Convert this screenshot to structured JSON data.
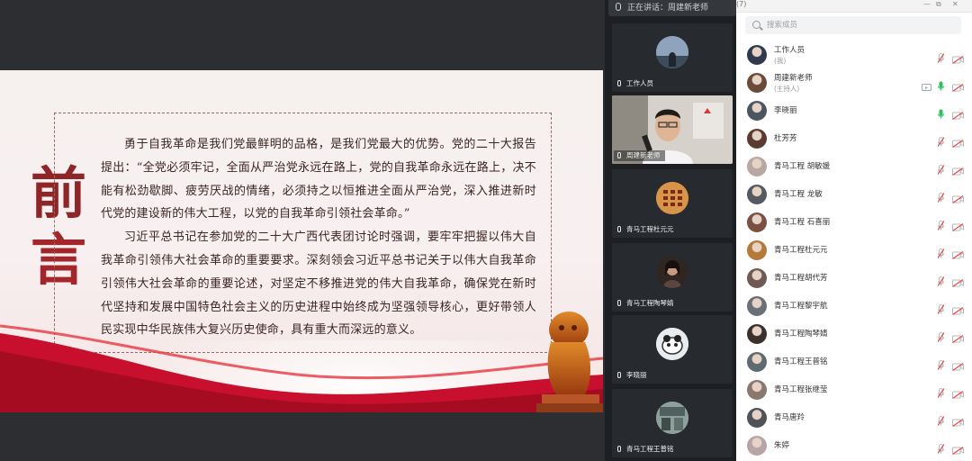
{
  "speaking": {
    "text": "正在讲话：周建新老师"
  },
  "slide": {
    "title": "前言",
    "paragraphs": [
      "勇于自我革命是我们党最鲜明的品格，是我们党最大的优势。党的二十大报告提出：“全党必须牢记，全面从严治党永远在路上，党的自我革命永远在路上，决不能有松劲歇脚、疲劳厌战的情绪，必须持之以恒推进全面从严治党，深入推进新时代党的建设新的伟大工程，以党的自我革命引领社会革命。”",
      "习近平总书记在参加党的二十大广西代表团讨论时强调，要牢牢把握以伟大自我革命引领伟大社会革命的重要要求。深刻领会习近平总书记关于以伟大自我革命引领伟大社会革命的重要论述，对坚定不移推进党的伟大自我革命，确保党在新时代坚持和发展中国特色社会主义的历史进程中始终成为坚强领导核心，更好带领人民实现中华民族伟大复兴历史使命，具有重大而深远的意义。"
    ]
  },
  "video_tiles": [
    {
      "label": "工作人员"
    },
    {
      "label": "周建新老师"
    },
    {
      "label": "青马工程杜元元"
    },
    {
      "label": "青马工程陶琴婧"
    },
    {
      "label": "李晓丽"
    },
    {
      "label": "青马工程王普铭"
    }
  ],
  "panel": {
    "header_text": "(7)",
    "search_placeholder": "搜索成员",
    "members": [
      {
        "name": "工作人员",
        "sub": "(我)",
        "mic": "off",
        "cam": "off",
        "avatar": "#2f3b4d"
      },
      {
        "name": "周建新老师",
        "sub": "(主持人)",
        "mic": "on",
        "cam": "off",
        "share": true,
        "avatar": "#6a4b3a"
      },
      {
        "name": "李晓丽",
        "sub": "",
        "mic": "on",
        "cam": "off",
        "avatar": "#4a5560"
      },
      {
        "name": "杜芳芳",
        "sub": "",
        "mic": "off",
        "cam": "off",
        "avatar": "#5b3a32"
      },
      {
        "name": "青马工程 胡敏媛",
        "sub": "",
        "mic": "off",
        "cam": "off",
        "avatar": "#b9a7a4"
      },
      {
        "name": "青马工程 龙敏",
        "sub": "",
        "mic": "off",
        "cam": "off",
        "avatar": "#555a60"
      },
      {
        "name": "青马工程 石喜丽",
        "sub": "",
        "mic": "off",
        "cam": "off",
        "avatar": "#7a4f44"
      },
      {
        "name": "青马工程杜元元",
        "sub": "",
        "mic": "off",
        "cam": "off",
        "avatar": "#b57a3a"
      },
      {
        "name": "青马工程胡代芳",
        "sub": "",
        "mic": "off",
        "cam": "off",
        "avatar": "#6e5a52"
      },
      {
        "name": "青马工程黎宇航",
        "sub": "",
        "mic": "off",
        "cam": "off",
        "avatar": "#6b7078"
      },
      {
        "name": "青马工程陶琴婧",
        "sub": "",
        "mic": "off",
        "cam": "off",
        "avatar": "#3c302c"
      },
      {
        "name": "青马工程王普铭",
        "sub": "",
        "mic": "off",
        "cam": "off",
        "avatar": "#5d6a70"
      },
      {
        "name": "青马工程张继莹",
        "sub": "",
        "mic": "off",
        "cam": "off",
        "avatar": "#8a7770"
      },
      {
        "name": "青马唐羚",
        "sub": "",
        "mic": "off",
        "cam": "off",
        "avatar": "#4d5359"
      },
      {
        "name": "朱婷",
        "sub": "",
        "mic": "off",
        "cam": "off",
        "avatar": "#b8a3a5"
      }
    ]
  },
  "colors": {
    "accent_red": "#c8102e",
    "mic_green": "#2fbf5b",
    "mic_off_red": "#e04848"
  }
}
